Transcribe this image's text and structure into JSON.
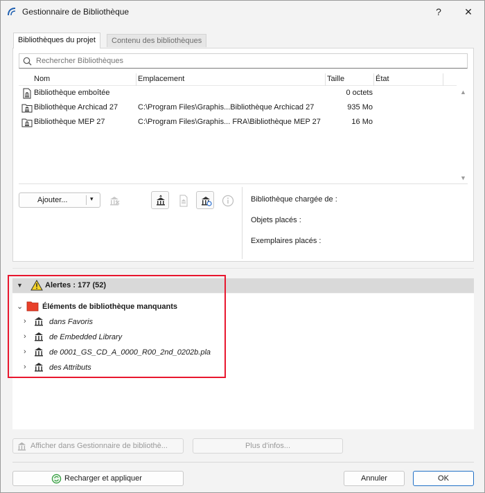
{
  "window": {
    "title": "Gestionnaire de Bibliothèque",
    "help_label": "?",
    "close_label": "✕"
  },
  "tabs": [
    {
      "label": "Bibliothèques du projet",
      "active": true
    },
    {
      "label": "Contenu des bibliothèques",
      "active": false
    }
  ],
  "search": {
    "placeholder": "Rechercher Bibliothèques",
    "value": ""
  },
  "table": {
    "columns": [
      "Nom",
      "Emplacement",
      "Taille",
      "État"
    ],
    "rows": [
      {
        "name": "Bibliothèque emboîtée",
        "location": "",
        "size": "0 octets",
        "state": "",
        "icon": "embedded-library-icon"
      },
      {
        "name": "Bibliothèque Archicad 27",
        "location": "C:\\Program Files\\Graphis...Bibliothèque Archicad 27",
        "size": "935 Mo",
        "state": "",
        "icon": "folder-library-icon"
      },
      {
        "name": "Bibliothèque MEP 27",
        "location": "C:\\Program Files\\Graphis... FRA\\Bibliothèque MEP 27",
        "size": "16 Mo",
        "state": "",
        "icon": "folder-library-icon"
      }
    ]
  },
  "toolbar": {
    "add_label": "Ajouter...",
    "dropdown_arrow": "▾"
  },
  "info": {
    "loaded_from": "Bibliothèque chargée de :",
    "placed_objects": "Objets placés :",
    "placed_instances": "Exemplaires placés :"
  },
  "alerts": {
    "label": "Alertes : 177 (52)",
    "group_label": "Éléments de bibliothèque manquants",
    "items": [
      "dans Favoris",
      "de Embedded Library",
      "de 0001_GS_CD_A_0000_R00_2nd_0202b.pla",
      "des Attributs"
    ]
  },
  "actions": {
    "show_in_manager": "Afficher dans Gestionnaire de bibliothè...",
    "more_info": "Plus d'infos...",
    "reload_apply": "Recharger et appliquer",
    "cancel": "Annuler",
    "ok": "OK"
  },
  "colors": {
    "highlight": "#e8162d",
    "folder_red": "#e8402a",
    "warning_yellow": "#f5d327",
    "reload_green": "#2e9a3a",
    "ok_border": "#1f6fc6"
  }
}
